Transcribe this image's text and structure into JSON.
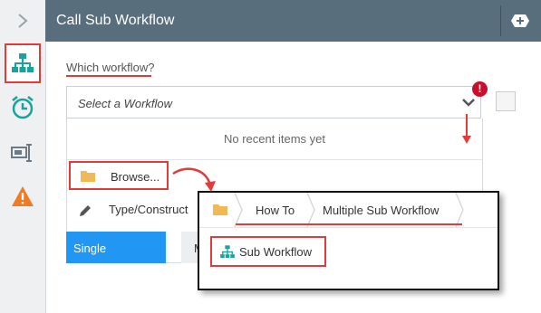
{
  "header": {
    "title": "Call Sub Workflow",
    "add_icon": "plus-icon"
  },
  "rail": {
    "collapse_icon": "chevron-right-icon",
    "items": [
      {
        "name": "workflow-icon",
        "active": true
      },
      {
        "name": "alarm-clock-icon",
        "active": false
      },
      {
        "name": "form-field-icon",
        "active": false
      },
      {
        "name": "warning-icon",
        "active": false
      }
    ]
  },
  "field": {
    "label": "Which workflow?",
    "placeholder": "Select a Workflow",
    "error_glyph": "!"
  },
  "dropdown": {
    "empty_message": "No recent items yet",
    "browse_label": "Browse...",
    "type_label": "Type/Construct"
  },
  "tabs": {
    "single": "Single",
    "multiple_partial": "M"
  },
  "browser": {
    "breadcrumbs": [
      "How To",
      "Multiple Sub Workflow"
    ],
    "items": [
      {
        "label": "Sub Workflow"
      }
    ]
  },
  "colors": {
    "header": "#596e7d",
    "accent_red": "#e33b3b",
    "active_blue": "#2196f3",
    "teal_icon": "#1aa39a",
    "folder": "#f0b955",
    "warning": "#f07b22",
    "error": "#c8102e"
  }
}
